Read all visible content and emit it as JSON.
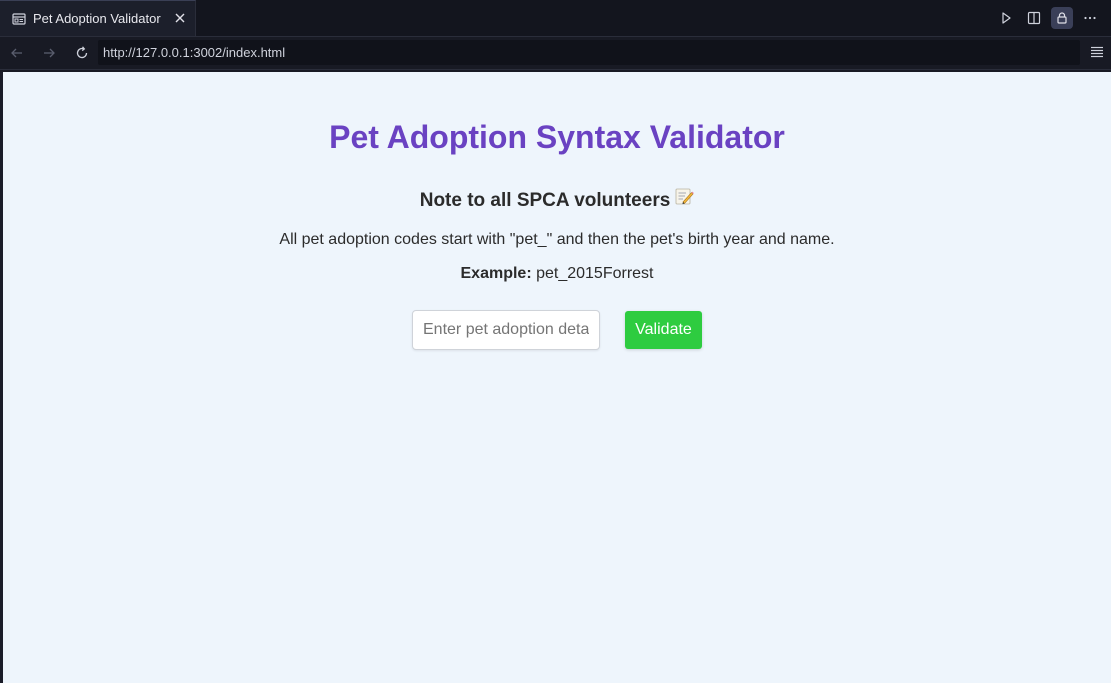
{
  "browser": {
    "tab": {
      "title": "Pet Adoption Validator",
      "icon": "page-icon",
      "close_icon": "close-icon"
    },
    "actions": [
      {
        "name": "run-icon"
      },
      {
        "name": "split-view-icon"
      },
      {
        "name": "lock-icon"
      },
      {
        "name": "more-icon"
      }
    ],
    "nav": {
      "back_icon": "arrow-left-icon",
      "forward_icon": "arrow-right-icon",
      "reload_icon": "reload-icon",
      "url": "http://127.0.0.1:3002/index.html",
      "menu_icon": "menu-icon"
    }
  },
  "page": {
    "title": "Pet Adoption Syntax Validator",
    "note_heading": "Note to all SPCA volunteers",
    "note_emoji": "memo-icon",
    "description": "All pet adoption codes start with \"pet_\" and then the pet's birth year and name.",
    "example_label": "Example:",
    "example_value": "pet_2015Forrest",
    "input": {
      "value": "",
      "placeholder": "Enter pet adoption details"
    },
    "validate_label": "Validate"
  },
  "colors": {
    "title": "#6a42c2",
    "button": "#2ecc40",
    "background": "#eef5fc",
    "chrome": "#13151e"
  }
}
